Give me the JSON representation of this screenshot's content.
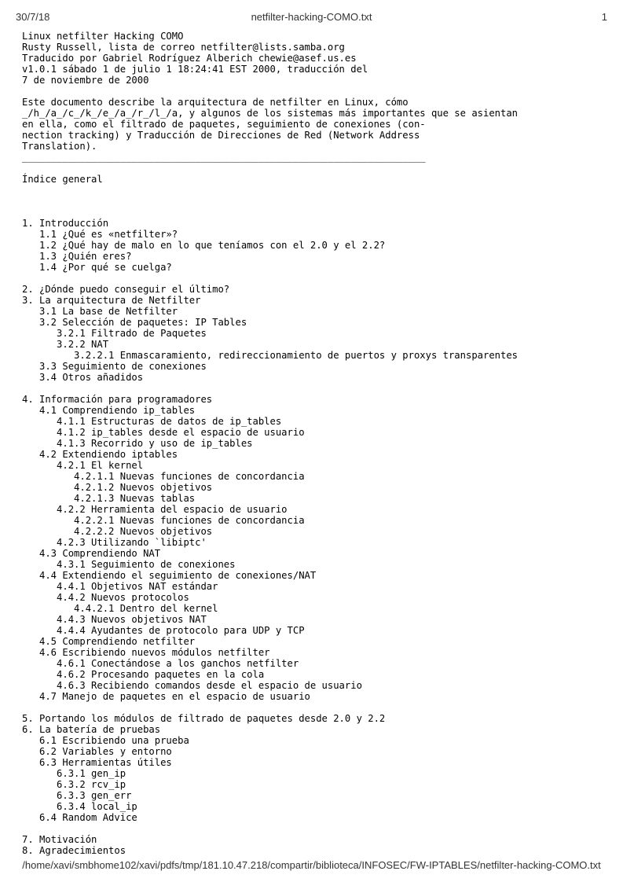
{
  "header": {
    "date": "30/7/18",
    "title": "netfilter-hacking-COMO.txt",
    "page": "1"
  },
  "footer": {
    "path": "/home/xavi/smbhome102/xavi/pdfs/tmp/181.10.47.218/compartir/biblioteca/INFOSEC/FW-IPTABLES/netfilter-hacking-COMO.txt"
  },
  "lines": [
    "Linux netfilter Hacking COMO",
    "Rusty Russell, lista de correo netfilter@lists.samba.org",
    "Traducido por Gabriel Rodríguez Alberich chewie@asef.us.es",
    "v1.0.1 sábado 1 de julio 1 18:24:41 EST 2000, traducción del",
    "7 de noviembre de 2000",
    "",
    "Este documento describe la arquitectura de netfilter en Linux, cómo",
    "_/h_/a_/c_/k_/e_/a_/r_/l_/a, y algunos de los sistemas más importantes que se asientan",
    "en ella, como el filtrado de paquetes, seguimiento de conexiones (con-",
    "nection tracking) y Traducción de Direcciones de Red (Network Address",
    "Translation).",
    "______________________________________________________________________",
    "",
    "Índice general",
    "",
    "",
    "",
    "1. Introducción",
    "   1.1 ¿Qué es «netfilter»?",
    "   1.2 ¿Qué hay de malo en lo que teníamos con el 2.0 y el 2.2?",
    "   1.3 ¿Quién eres?",
    "   1.4 ¿Por qué se cuelga?",
    "",
    "2. ¿Dónde puedo conseguir el último?",
    "3. La arquitectura de Netfilter",
    "   3.1 La base de Netfilter",
    "   3.2 Selección de paquetes: IP Tables",
    "      3.2.1 Filtrado de Paquetes",
    "      3.2.2 NAT",
    "         3.2.2.1 Enmascaramiento, redireccionamiento de puertos y proxys transparentes",
    "   3.3 Seguimiento de conexiones",
    "   3.4 Otros añadidos",
    "",
    "4. Información para programadores",
    "   4.1 Comprendiendo ip_tables",
    "      4.1.1 Estructuras de datos de ip_tables",
    "      4.1.2 ip_tables desde el espacio de usuario",
    "      4.1.3 Recorrido y uso de ip_tables",
    "   4.2 Extendiendo iptables",
    "      4.2.1 El kernel",
    "         4.2.1.1 Nuevas funciones de concordancia",
    "         4.2.1.2 Nuevos objetivos",
    "         4.2.1.3 Nuevas tablas",
    "      4.2.2 Herramienta del espacio de usuario",
    "         4.2.2.1 Nuevas funciones de concordancia",
    "         4.2.2.2 Nuevos objetivos",
    "      4.2.3 Utilizando `libiptc'",
    "   4.3 Comprendiendo NAT",
    "      4.3.1 Seguimiento de conexiones",
    "   4.4 Extendiendo el seguimiento de conexiones/NAT",
    "      4.4.1 Objetivos NAT estándar",
    "      4.4.2 Nuevos protocolos",
    "         4.4.2.1 Dentro del kernel",
    "      4.4.3 Nuevos objetivos NAT",
    "      4.4.4 Ayudantes de protocolo para UDP y TCP",
    "   4.5 Comprendiendo netfilter",
    "   4.6 Escribiendo nuevos módulos netfilter",
    "      4.6.1 Conectándose a los ganchos netfilter",
    "      4.6.2 Procesando paquetes en la cola",
    "      4.6.3 Recibiendo comandos desde el espacio de usuario",
    "   4.7 Manejo de paquetes en el espacio de usuario",
    "",
    "5. Portando los módulos de filtrado de paquetes desde 2.0 y 2.2",
    "6. La batería de pruebas",
    "   6.1 Escribiendo una prueba",
    "   6.2 Variables y entorno",
    "   6.3 Herramientas útiles",
    "      6.3.1 gen_ip",
    "      6.3.2 rcv_ip",
    "      6.3.3 gen_err",
    "      6.3.4 local_ip",
    "   6.4 Random Advice",
    "",
    "7. Motivación",
    "8. Agradecimientos"
  ]
}
